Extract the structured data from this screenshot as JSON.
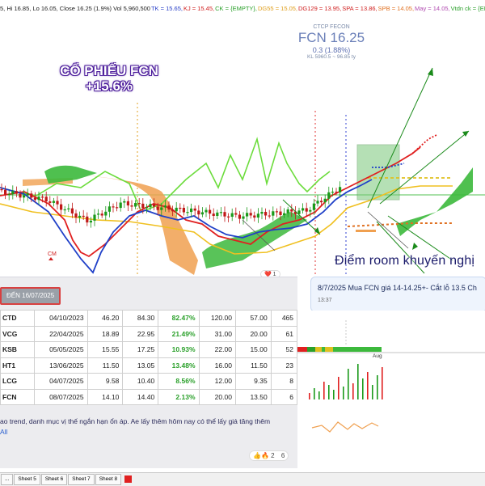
{
  "topbar": [
    {
      "t": "5, Hi 16.85, Lo 16.05, Close 16.25 (1.9%) Vol 5,960,500",
      "c": "#222222"
    },
    {
      "t": "TK = 15.65,",
      "c": "#2a40c8"
    },
    {
      "t": "KJ = 15.45,",
      "c": "#d02020"
    },
    {
      "t": "CK = {EMPTY},",
      "c": "#2aa02a"
    },
    {
      "t": "DG55 = 15.05,",
      "c": "#e0a020"
    },
    {
      "t": "DG129 = 13.95,",
      "c": "#d02020"
    },
    {
      "t": "SPA = 13.86,",
      "c": "#d02020"
    },
    {
      "t": "SPB = 14.05,",
      "c": "#e07020"
    },
    {
      "t": "May = 14.05,",
      "c": "#b04ab0"
    },
    {
      "t": "Vtdn ck = {EMPTY}",
      "c": "#2aa02a"
    }
  ],
  "stock": {
    "company": "CTCP FECON",
    "ticker_price": "FCN 16.25",
    "change": "0.3 (1.88%)",
    "volume": "KL 5960.5 ~ 96.85 ty"
  },
  "headline": {
    "line1": "CỔ PHIẾU FCN",
    "line2": "+15.6%"
  },
  "cm_label": "CM",
  "room_text": "Điểm room khuyến nghị",
  "panel": {
    "date_chip": "ĐẾN 16/07/2025",
    "table": [
      [
        "CTD",
        "04/10/2023",
        "46.20",
        "84.30",
        "82.47%",
        "120.00",
        "57.00",
        "465"
      ],
      [
        "VCG",
        "22/04/2025",
        "18.89",
        "22.95",
        "21.49%",
        "31.00",
        "20.00",
        "61"
      ],
      [
        "KSB",
        "05/05/2025",
        "15.55",
        "17.25",
        "10.93%",
        "22.00",
        "15.00",
        "52"
      ],
      [
        "HT1",
        "13/06/2025",
        "11.50",
        "13.05",
        "13.48%",
        "16.00",
        "11.50",
        "23"
      ],
      [
        "LCG",
        "04/07/2025",
        "9.58",
        "10.40",
        "8.56%",
        "12.00",
        "9.35",
        "8"
      ],
      [
        "FCN",
        "08/07/2025",
        "14.10",
        "14.40",
        "2.13%",
        "20.00",
        "13.50",
        "6"
      ]
    ],
    "message": "ao trend, danh mục vị thế ngắn hạn ổn áp. Ae lấy thêm hôm nay có thể lấy giá tăng thêm",
    "more": "All",
    "reactions": "👍🔥 2",
    "reaction_count": "6"
  },
  "top_reaction": "❤️ 1",
  "bubble": {
    "text": "8/7/2025 Mua FCN giá 14-14.25+- Cắt lỗ 13.5 Ch",
    "time": "13:37"
  },
  "lower_axis_label": "Aug",
  "sheets": [
    "Sheet 5",
    "Sheet 6",
    "Sheet 7",
    "Sheet 8"
  ],
  "sheets_more": "..."
}
